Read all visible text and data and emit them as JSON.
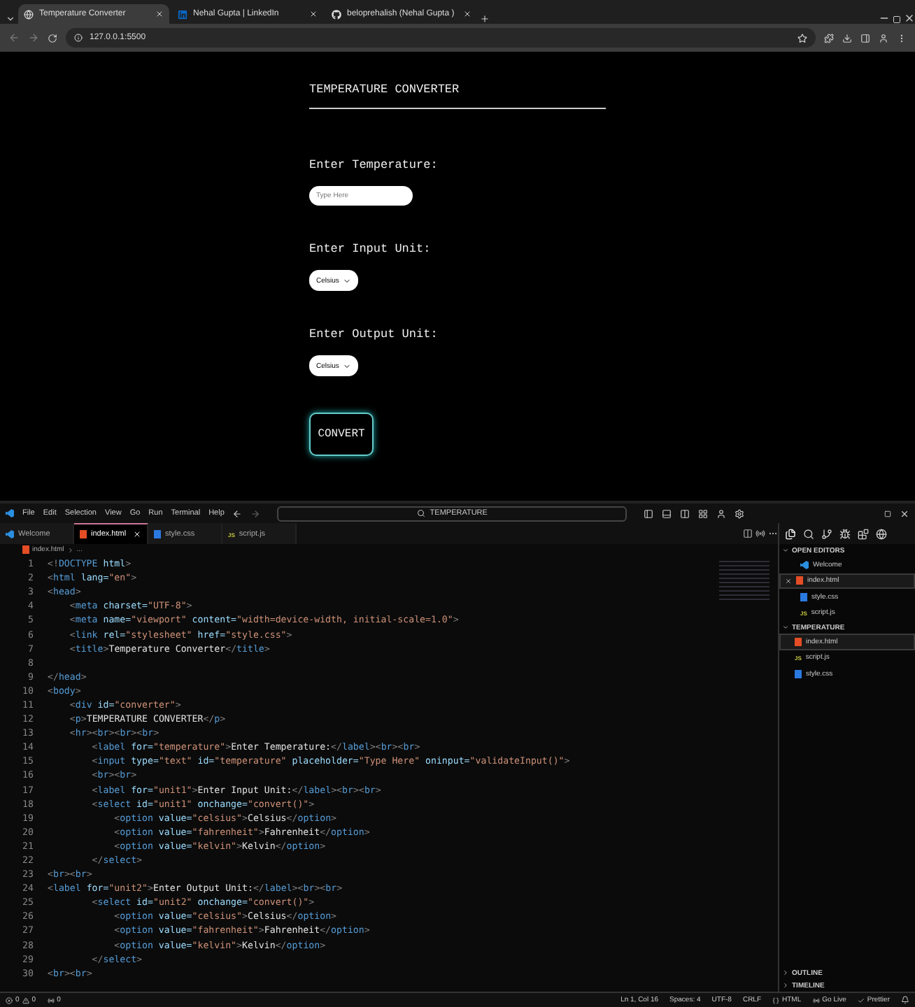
{
  "browser": {
    "tabs": [
      {
        "title": "Temperature Converter",
        "kind": "globe",
        "selected": true
      },
      {
        "title": "Nehal Gupta | LinkedIn",
        "kind": "linkedin",
        "selected": false
      },
      {
        "title": "beloprehalish (Nehal Gupta )",
        "kind": "github",
        "selected": false
      }
    ],
    "address": "127.0.0.1:5500"
  },
  "page": {
    "title": "TEMPERATURE CONVERTER",
    "temperature_label": "Enter Temperature:",
    "temperature_placeholder": "Type Here",
    "input_unit_label": "Enter Input Unit:",
    "input_unit": "Celsius",
    "output_unit_label": "Enter Output Unit:",
    "output_unit": "Celsius",
    "convert_button": "CONVERT"
  },
  "editor": {
    "menu": [
      "File",
      "Edit",
      "Selection",
      "View",
      "Go",
      "Run",
      "Terminal",
      "Help"
    ],
    "search": "TEMPERATURE",
    "tabs": [
      {
        "label": "Welcome",
        "kind": "vscode",
        "selected": false
      },
      {
        "label": "index.html",
        "kind": "html",
        "selected": true
      },
      {
        "label": "style.css",
        "kind": "css",
        "selected": false
      },
      {
        "label": "script.js",
        "kind": "js",
        "icon_text": "JS",
        "selected": false
      }
    ],
    "breadcrumb": [
      "index.html",
      "..."
    ],
    "lines": [
      {
        "n": "1",
        "text": "<!DOCTYPE html>"
      },
      {
        "n": "2",
        "text": "<html lang=\"en\">"
      },
      {
        "n": "3",
        "text": "<head>"
      },
      {
        "n": "4",
        "text": "    <meta charset=\"UTF-8\">"
      },
      {
        "n": "5",
        "text": "    <meta name=\"viewport\" content=\"width=device-width, initial-scale=1.0\">"
      },
      {
        "n": "6",
        "text": "    <link rel=\"stylesheet\" href=\"style.css\">"
      },
      {
        "n": "7",
        "text": "    <title>Temperature Converter</title>"
      },
      {
        "n": "8"
      },
      {
        "n": "9",
        "text": "</head>"
      },
      {
        "n": "10",
        "text": "<body>"
      },
      {
        "n": "11",
        "text": "    <div id=\"converter\">"
      },
      {
        "n": "12",
        "text": "    <p>TEMPERATURE CONVERTER</p>"
      },
      {
        "n": "13",
        "text": "    <hr><br><br><br>"
      },
      {
        "n": "14",
        "text": "        <label for=\"temperature\">Enter Temperature:</label><br><br>"
      },
      {
        "n": "15",
        "text": "        <input type=\"text\" id=\"temperature\" placeholder=\"Type Here\" oninput=\"validateInput()\">"
      },
      {
        "n": "16",
        "text": "        <br><br>"
      },
      {
        "n": "17",
        "text": "        <label for=\"unit1\">Enter Input Unit:</label><br><br>"
      },
      {
        "n": "18",
        "text": "        <select id=\"unit1\" onchange=\"convert()\">"
      },
      {
        "n": "19",
        "text": "            <option value=\"celsius\">Celsius</option>"
      },
      {
        "n": "20",
        "text": "            <option value=\"fahrenheit\">Fahrenheit</option>"
      },
      {
        "n": "21",
        "text": "            <option value=\"kelvin\">Kelvin</option>"
      },
      {
        "n": "22",
        "text": "        </select>"
      },
      {
        "n": "23",
        "text": "<br><br>"
      },
      {
        "n": "24",
        "text": "<label for=\"unit2\">Enter Output Unit:</label><br><br>"
      },
      {
        "n": "25",
        "text": "        <select id=\"unit2\" onchange=\"convert()\">"
      },
      {
        "n": "26",
        "text": "            <option value=\"celsius\">Celsius</option>"
      },
      {
        "n": "27",
        "text": "            <option value=\"fahrenheit\">Fahrenheit</option>"
      },
      {
        "n": "28",
        "text": "            <option value=\"kelvin\">Kelvin</option>"
      },
      {
        "n": "29",
        "text": "        </select>"
      },
      {
        "n": "30",
        "text": "<br><br>"
      }
    ],
    "sidebar": {
      "open_editors_title": "OPEN EDITORS",
      "open_editors": [
        {
          "label": "Welcome",
          "kind": "vscode",
          "selected": false
        },
        {
          "label": "index.html",
          "kind": "html",
          "selected": true
        },
        {
          "label": "style.css",
          "kind": "css",
          "selected": false
        },
        {
          "label": "script.js",
          "kind": "js",
          "icon_text": "JS",
          "selected": false
        }
      ],
      "folder_title": "TEMPERATURE",
      "files": [
        {
          "label": "index.html",
          "kind": "html",
          "selected": true
        },
        {
          "label": "script.js",
          "kind": "js",
          "icon_text": "JS",
          "selected": false
        },
        {
          "label": "style.css",
          "kind": "css",
          "selected": false
        }
      ],
      "outline": "OUTLINE",
      "timeline": "TIMELINE"
    },
    "status": {
      "errors": "0",
      "warnings": "0",
      "ports": "0",
      "right": [
        "Ln 1, Col 16",
        "Spaces: 4",
        "UTF-8",
        "CRLF",
        "HTML",
        "Go Live",
        "Prettier"
      ]
    }
  }
}
